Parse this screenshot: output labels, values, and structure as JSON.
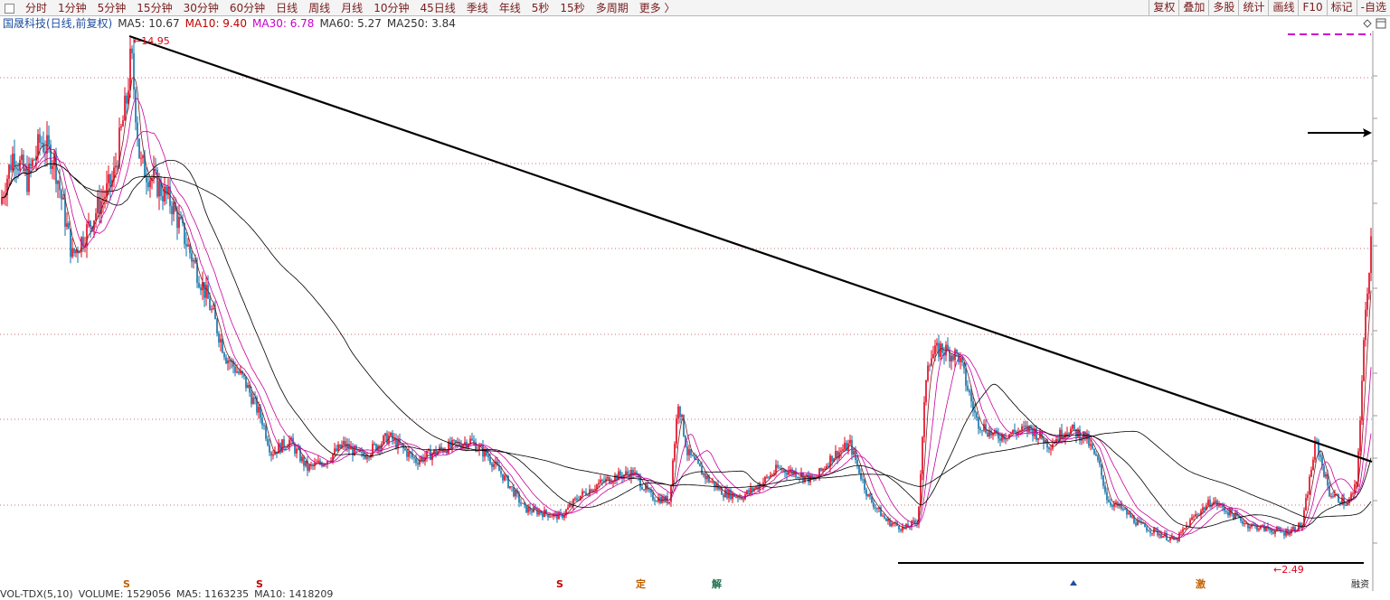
{
  "toolbar": {
    "period_tabs": [
      "分时",
      "1分钟",
      "5分钟",
      "15分钟",
      "30分钟",
      "60分钟",
      "日线",
      "周线",
      "月线",
      "10分钟",
      "45日线",
      "季线",
      "年线",
      "5秒",
      "15秒",
      "多周期",
      "更多 〉"
    ],
    "right_buttons": [
      "复权",
      "叠加",
      "多股",
      "统计",
      "画线",
      "F10",
      "标记",
      "-自选"
    ]
  },
  "legend": {
    "stock_title": "国晟科技(日线,前复权)",
    "ma5": "MA5: 10.67",
    "ma10": "MA10: 9.40",
    "ma30": "MA30: 6.78",
    "ma60": "MA60: 5.27",
    "ma250": "MA250: 3.84"
  },
  "colors": {
    "up": "#e0001a",
    "down": "#0b6fa8",
    "ma5": "#7a1d20",
    "ma10": "#c8009c",
    "ma30": "#c8009c",
    "ma60": "#000000",
    "ma250": "#000000",
    "grid": "#c87070"
  },
  "annotations": {
    "high_label": "←14.95",
    "low_label": "←2.49",
    "markers": [
      "S",
      "S",
      "S",
      "定",
      "解",
      "激"
    ],
    "end_marker": "融资"
  },
  "volume": {
    "label": "VOL-TDX(5,10)",
    "volume": "VOLUME: 1529056",
    "ma5": "MA5: 1163235",
    "ma10": "MA10: 1418209"
  },
  "chart_data": {
    "type": "candlestick",
    "price_high": 14.95,
    "price_low": 2.49,
    "approx_close_path": [
      [
        0,
        11.2
      ],
      [
        15,
        12.5
      ],
      [
        30,
        11.8
      ],
      [
        45,
        12.8
      ],
      [
        60,
        12.3
      ],
      [
        80,
        9.9
      ],
      [
        95,
        10.5
      ],
      [
        110,
        11.2
      ],
      [
        125,
        11.8
      ],
      [
        140,
        13.8
      ],
      [
        145,
        14.95
      ],
      [
        155,
        12.2
      ],
      [
        170,
        11.8
      ],
      [
        190,
        11.2
      ],
      [
        210,
        10.0
      ],
      [
        230,
        8.8
      ],
      [
        250,
        7.4
      ],
      [
        270,
        6.8
      ],
      [
        290,
        5.8
      ],
      [
        300,
        5.0
      ],
      [
        320,
        5.3
      ],
      [
        340,
        4.6
      ],
      [
        360,
        4.8
      ],
      [
        380,
        5.2
      ],
      [
        400,
        4.9
      ],
      [
        430,
        5.4
      ],
      [
        460,
        4.8
      ],
      [
        490,
        5.1
      ],
      [
        520,
        5.3
      ],
      [
        540,
        4.9
      ],
      [
        560,
        4.3
      ],
      [
        580,
        3.6
      ],
      [
        600,
        3.5
      ],
      [
        620,
        3.4
      ],
      [
        640,
        3.9
      ],
      [
        660,
        4.2
      ],
      [
        680,
        4.4
      ],
      [
        700,
        4.5
      ],
      [
        720,
        3.9
      ],
      [
        740,
        3.8
      ],
      [
        750,
        6.3
      ],
      [
        760,
        5.0
      ],
      [
        780,
        4.4
      ],
      [
        800,
        4.0
      ],
      [
        820,
        3.9
      ],
      [
        840,
        4.2
      ],
      [
        860,
        4.6
      ],
      [
        880,
        4.5
      ],
      [
        900,
        4.3
      ],
      [
        920,
        4.9
      ],
      [
        940,
        5.2
      ],
      [
        960,
        3.9
      ],
      [
        980,
        3.3
      ],
      [
        1000,
        3.1
      ],
      [
        1015,
        3.3
      ],
      [
        1025,
        7.3
      ],
      [
        1040,
        7.6
      ],
      [
        1060,
        7.4
      ],
      [
        1080,
        5.8
      ],
      [
        1100,
        5.4
      ],
      [
        1120,
        5.5
      ],
      [
        1140,
        5.6
      ],
      [
        1160,
        5.2
      ],
      [
        1180,
        5.6
      ],
      [
        1200,
        5.4
      ],
      [
        1215,
        4.7
      ],
      [
        1225,
        3.8
      ],
      [
        1240,
        3.6
      ],
      [
        1260,
        3.2
      ],
      [
        1280,
        3.0
      ],
      [
        1300,
        2.8
      ],
      [
        1320,
        3.4
      ],
      [
        1340,
        3.8
      ],
      [
        1360,
        3.5
      ],
      [
        1380,
        3.2
      ],
      [
        1400,
        3.1
      ],
      [
        1420,
        3.0
      ],
      [
        1440,
        3.2
      ],
      [
        1455,
        5.3
      ],
      [
        1470,
        4.0
      ],
      [
        1490,
        3.7
      ],
      [
        1500,
        4.2
      ],
      [
        1510,
        8.5
      ],
      [
        1517,
        10.67
      ]
    ]
  }
}
